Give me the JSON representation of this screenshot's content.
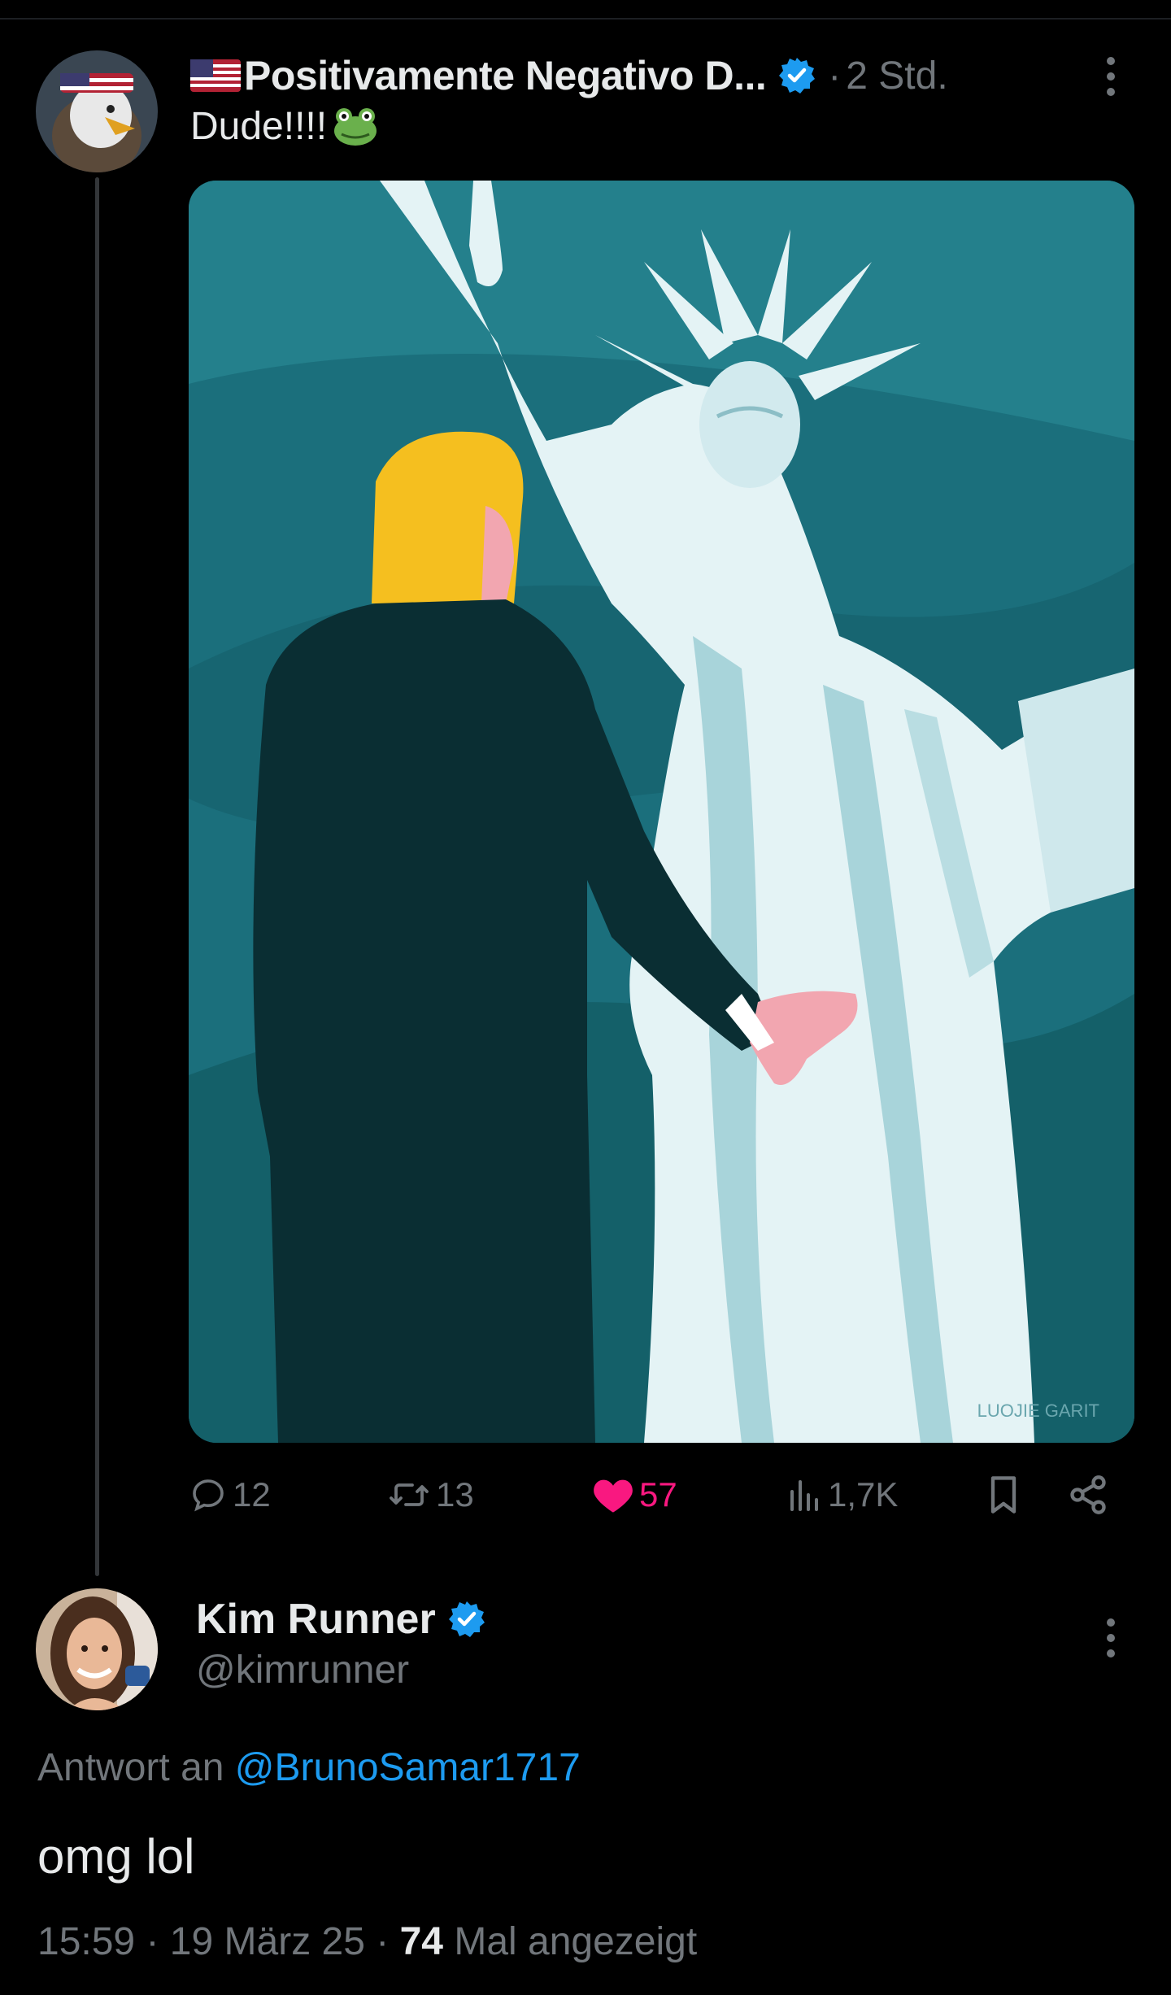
{
  "post": {
    "author_name": "Positivamente Negativo D...",
    "flag_emoji": "us-flag-emoji",
    "verified_icon": "verified-badge-icon",
    "separator": "·",
    "time": "2 Std.",
    "text": "Dude!!!!",
    "text_emoji": "frog-emoji",
    "media_watermark": "LUOJIE GARIT",
    "actions": {
      "replies": "12",
      "reposts": "13",
      "likes": "57",
      "views": "1,7K"
    }
  },
  "reply": {
    "author_name": "Kim Runner",
    "handle": "@kimrunner",
    "reply_to_label": "Antwort an",
    "reply_to_handle": "@BrunoSamar1717",
    "text": "omg lol",
    "time": "15:59",
    "date": "19 März 25",
    "separator": "·",
    "views_count": "74",
    "views_label": "Mal angezeigt"
  },
  "colors": {
    "background": "#000000",
    "text_primary": "#e7e9ea",
    "text_secondary": "#71767b",
    "accent_blue": "#1d9bf0",
    "like_pink": "#f91880",
    "media_teal": "#1b6f7c"
  }
}
